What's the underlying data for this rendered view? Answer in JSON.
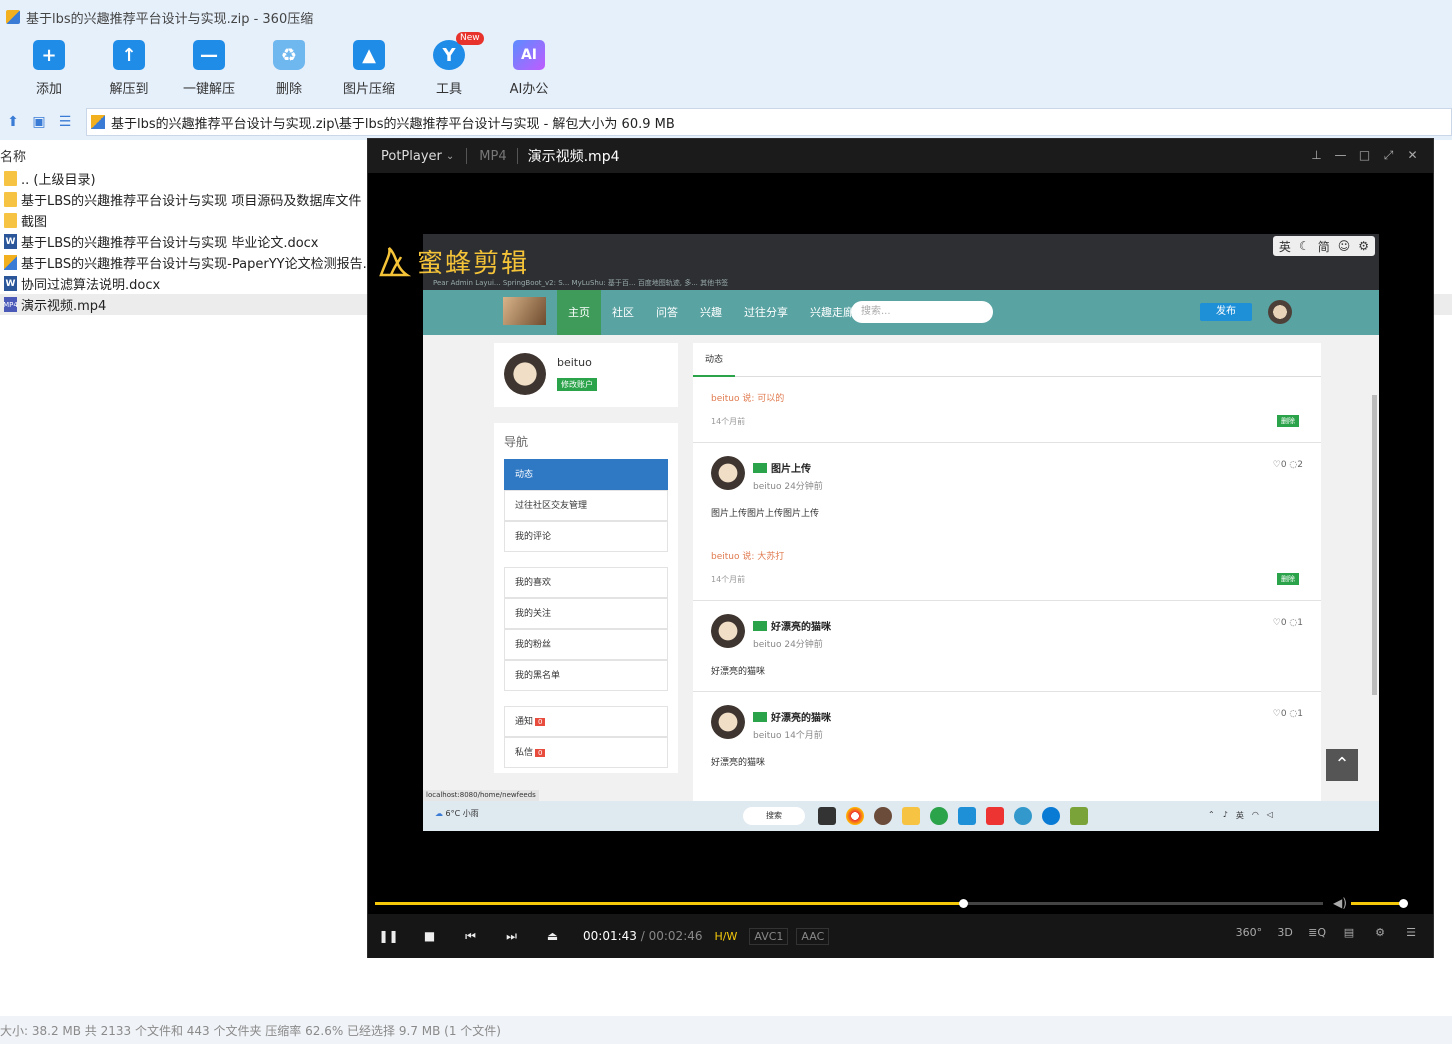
{
  "window": {
    "title": "基于lbs的兴趣推荐平台设计与实现.zip - 360压缩"
  },
  "toolbar": [
    {
      "label": "添加",
      "icon": "add-icon",
      "glyph": "+"
    },
    {
      "label": "解压到",
      "icon": "extract-to-icon",
      "glyph": "↑"
    },
    {
      "label": "一键解压",
      "icon": "one-click-extract-icon",
      "glyph": "—"
    },
    {
      "label": "删除",
      "icon": "delete-icon",
      "glyph": "♻"
    },
    {
      "label": "图片压缩",
      "icon": "image-compress-icon",
      "glyph": "▲"
    },
    {
      "label": "工具",
      "icon": "tools-icon",
      "glyph": "Y",
      "badge": "New"
    },
    {
      "label": "AI办公",
      "icon": "ai-office-icon",
      "glyph": "AI"
    }
  ],
  "address": {
    "path": "基于lbs的兴趣推荐平台设计与实现.zip\\基于lbs的兴趣推荐平台设计与实现 - 解包大小为 60.9 MB"
  },
  "columns": {
    "name": "名称"
  },
  "files": [
    {
      "name": ".. (上级目录)",
      "type": "folder"
    },
    {
      "name": "基于LBS的兴趣推荐平台设计与实现 项目源码及数据库文件",
      "type": "folder"
    },
    {
      "name": "截图",
      "type": "folder"
    },
    {
      "name": "基于LBS的兴趣推荐平台设计与实现 毕业论文.docx",
      "type": "word"
    },
    {
      "name": "基于LBS的兴趣推荐平台设计与实现-PaperYY论文检测报告.zip",
      "type": "zip"
    },
    {
      "name": "协同过滤算法说明.docx",
      "type": "word"
    },
    {
      "name": "演示视频.mp4",
      "type": "video",
      "selected": true
    }
  ],
  "status": {
    "text": "大小: 38.2 MB 共 2133 个文件和 443 个文件夹 压缩率 62.6% 已经选择 9.7 MB (1 个文件)"
  },
  "player": {
    "app_name": "PotPlayer",
    "format": "MP4",
    "file": "演示视频.mp4",
    "watermark": "蜜蜂剪辑",
    "time_current": "00:01:43",
    "time_separator": "/",
    "time_total": "00:02:46",
    "progress": 0.62,
    "volume": 0.92,
    "codecs": [
      "H/W",
      "AVC1",
      "AAC"
    ],
    "right_buttons": [
      "360°",
      "3D",
      "≣Q",
      "▤",
      "⚙",
      "☰"
    ]
  },
  "video": {
    "ime": [
      "英",
      "简"
    ],
    "bookmarks": "Pear Admin Layui...   SpringBoot_v2: S...   MyLuShu: 基于百...   百度地图轨迹, 多...   其他书签",
    "site_nav": [
      "主页",
      "社区",
      "问答",
      "兴趣",
      "过往分享",
      "兴趣走廊"
    ],
    "search_placeholder": "搜索...",
    "publish": "发布",
    "username": "beituo",
    "edit_account": "修改账户",
    "nav_title": "导航",
    "nav_items": [
      "动态",
      "过往社区交友管理",
      "我的评论"
    ],
    "nav_items2": [
      "我的喜欢",
      "我的关注",
      "我的粉丝",
      "我的黑名单"
    ],
    "notify": "通知",
    "message": "私信",
    "notify_count": "0",
    "message_count": "0",
    "tab": "动态",
    "comment1": "beituo 说: 可以的",
    "comment1_time": "14个月前",
    "delete": "删除",
    "post1_title": "图片上传",
    "post1_meta": "beituo 24分钟前",
    "post1_stats": "♡0 ◌2",
    "post1_text": "图片上传图片上传图片上传",
    "comment2": "beituo 说: 大苏打",
    "comment2_time": "14个月前",
    "post2_title": "好漂亮的猫咪",
    "post2_meta": "beituo 24分钟前",
    "post2_stats": "♡0 ◌1",
    "post2_text": "好漂亮的猫咪",
    "post3_title": "好漂亮的猫咪",
    "post3_meta": "beituo 14个月前",
    "post3_stats": "♡0 ◌1",
    "post3_text": "好漂亮的猫咪",
    "status_url": "localhost:8080/home/newfeeds",
    "weather_temp": "6°C",
    "weather_desc": "小雨",
    "taskbar_search": "搜索",
    "tray_lang": "英"
  }
}
